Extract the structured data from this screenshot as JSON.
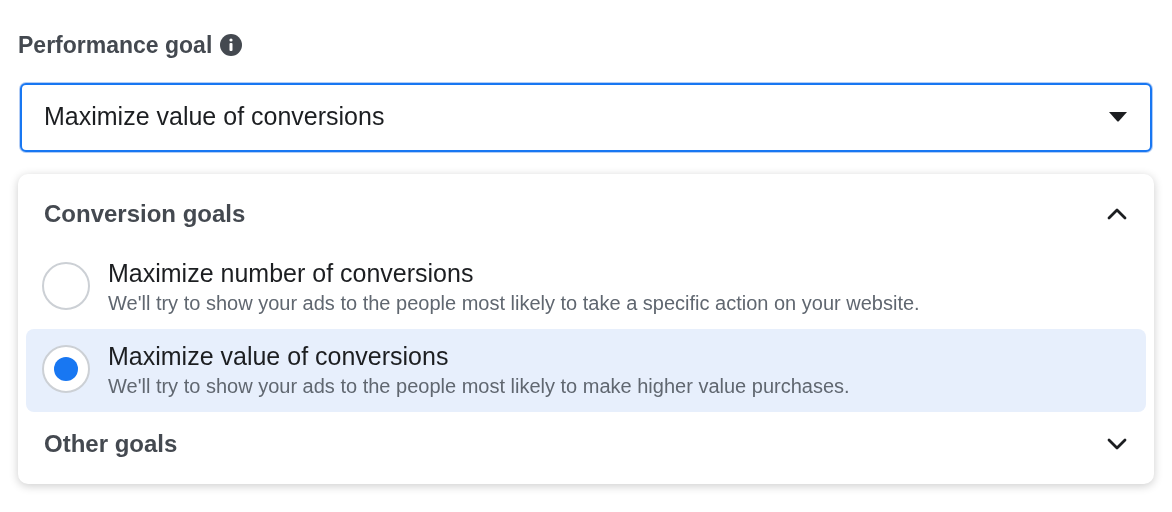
{
  "field": {
    "label": "Performance goal",
    "value": "Maximize value of conversions",
    "focused": true
  },
  "groups": [
    {
      "title": "Conversion goals",
      "expanded": true,
      "options": [
        {
          "title": "Maximize number of conversions",
          "description": "We'll try to show your ads to the people most likely to take a specific action on your website.",
          "selected": false
        },
        {
          "title": "Maximize value of conversions",
          "description": "We'll try to show your ads to the people most likely to make higher value purchases.",
          "selected": true
        }
      ]
    },
    {
      "title": "Other goals",
      "expanded": false
    }
  ]
}
